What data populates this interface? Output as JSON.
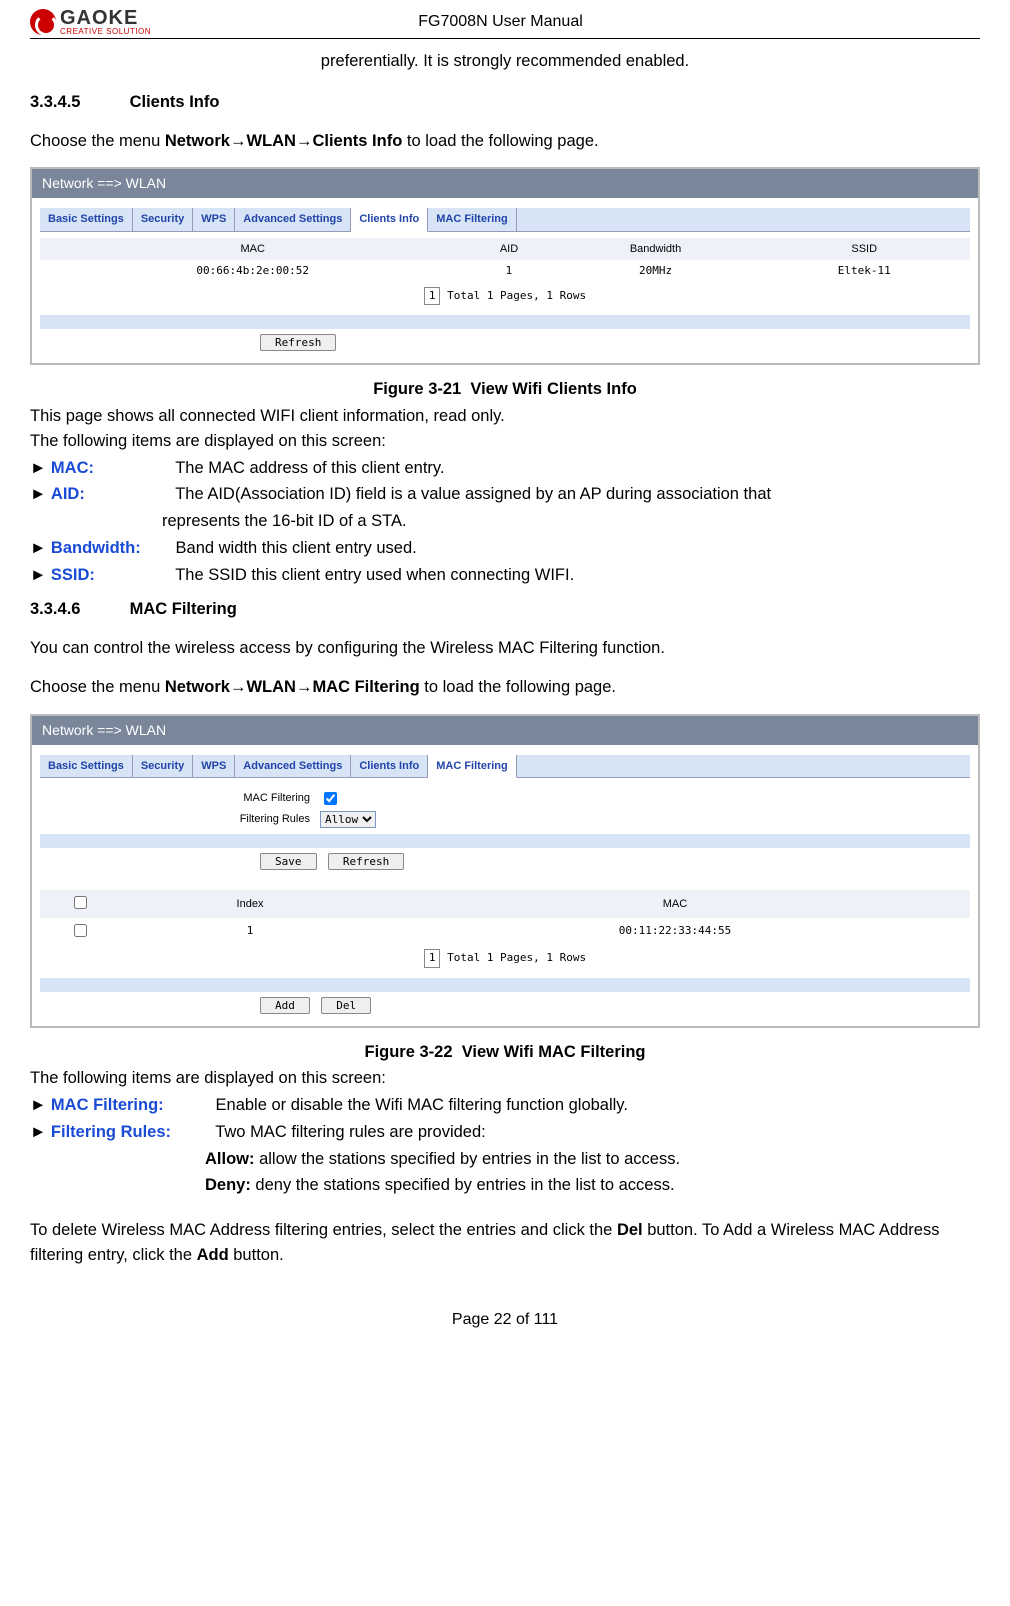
{
  "header": {
    "logo_main": "GAOKE",
    "logo_sub": "CREATIVE SOLUTION",
    "doc_title": "FG7008N User Manual"
  },
  "frag_intro": "preferentially. It is strongly recommended enabled.",
  "sec1": {
    "num": "3.3.4.5",
    "title": "Clients Info",
    "menu_pre": "Choose the menu ",
    "menu_bold1": "Network",
    "arrow": "→",
    "menu_bold2": "WLAN",
    "menu_bold3": "Clients Info",
    "menu_post": " to load the following page."
  },
  "ss1": {
    "breadcrumb": "Network ==> WLAN",
    "tabs": [
      "Basic Settings",
      "Security",
      "WPS",
      "Advanced Settings",
      "Clients Info",
      "MAC Filtering"
    ],
    "active_tab": 4,
    "cols": [
      "MAC",
      "AID",
      "Bandwidth",
      "SSID"
    ],
    "row": {
      "mac": "00:66:4b:2e:00:52",
      "aid": "1",
      "bw": "20MHz",
      "ssid": "Eltek-11"
    },
    "pager_box": "1",
    "pager_text": "Total 1 Pages, 1 Rows",
    "refresh": "Refresh"
  },
  "fig1": {
    "num": "Figure 3-21",
    "title": "View Wifi Clients Info"
  },
  "desc1_a": "This page shows all connected WIFI client information, read only.",
  "desc1_b": "The following items are displayed on this screen:",
  "items1": {
    "mac_l": "MAC:",
    "mac_d": "The MAC address of this client entry.",
    "aid_l": "AID:",
    "aid_d": "The AID(Association ID) field is a value assigned by an AP during association that represents the 16-bit ID of a STA.",
    "bw_l": "Bandwidth:",
    "bw_d": "Band width this client entry used.",
    "ssid_l": "SSID:",
    "ssid_d": "The SSID this client entry used when connecting WIFI."
  },
  "sec2": {
    "num": "3.3.4.6",
    "title": "MAC Filtering",
    "intro": "You can control the wireless access by configuring the Wireless MAC Filtering function.",
    "menu_pre": "Choose the menu ",
    "menu_bold1": "Network",
    "arrow": "→",
    "menu_bold2": "WLAN",
    "menu_bold3": "MAC Filtering",
    "menu_post": " to load the following page."
  },
  "ss2": {
    "breadcrumb": "Network ==> WLAN",
    "tabs": [
      "Basic Settings",
      "Security",
      "WPS",
      "Advanced Settings",
      "Clients Info",
      "MAC Filtering"
    ],
    "active_tab": 5,
    "form": {
      "mf_label": "MAC Filtering",
      "fr_label": "Filtering Rules",
      "fr_value": "Allow"
    },
    "save": "Save",
    "refresh": "Refresh",
    "cols": [
      "",
      "Index",
      "MAC"
    ],
    "row": {
      "idx": "1",
      "mac": "00:11:22:33:44:55"
    },
    "pager_box": "1",
    "pager_text": "Total 1 Pages, 1 Rows",
    "add": "Add",
    "del": "Del"
  },
  "fig2": {
    "num": "Figure 3-22",
    "title": "View Wifi MAC Filtering"
  },
  "desc2": "The following items are displayed on this screen:",
  "items2": {
    "mf_l": "MAC Filtering:",
    "mf_d": "Enable or disable the Wifi MAC filtering function globally.",
    "fr_l": "Filtering Rules:",
    "fr_d": "Two MAC filtering rules are provided:",
    "allow_l": "Allow:",
    "allow_d": " allow the stations specified by entries in the list to access.",
    "deny_l": "Deny:",
    "deny_d": " deny the stations specified by entries in the list to access."
  },
  "outro_pre": "To delete Wireless MAC Address filtering entries, select the entries and click the ",
  "outro_del": "Del",
  "outro_mid": " button. To Add a Wireless MAC Address filtering entry, click the ",
  "outro_add": "Add",
  "outro_post": " button.",
  "footer": "Page 22 of 111"
}
